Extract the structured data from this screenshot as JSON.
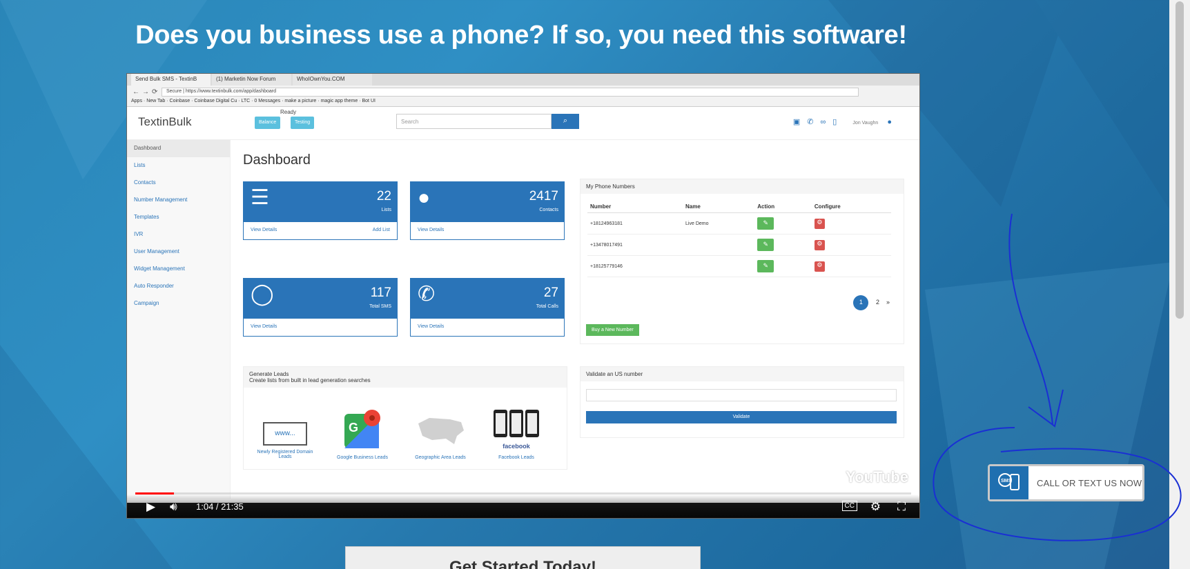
{
  "headline": "Does you business use a phone? If so, you need this software!",
  "video": {
    "browser": {
      "tabs": [
        "Send Bulk SMS - TextinB",
        "(1) Marketin Now Forum",
        "WhoIOwnYou.COM"
      ],
      "url": "Secure | https://www.textinbulk.com/app/dashboard",
      "bookmarks": [
        "Apps",
        "New Tab",
        "Coinbase",
        "Coinbase Digital Cu",
        "LTC",
        "0 Messages",
        "make a picture",
        "magic app theme",
        "Bot UI"
      ]
    },
    "app": {
      "logo": "TextinBulk",
      "status": "Ready",
      "mini_buttons": [
        "Balance",
        "Testing"
      ],
      "search_placeholder": "Search",
      "user_name": "Jon Vaughn",
      "sidebar": [
        "Dashboard",
        "Lists",
        "Contacts",
        "Number Management",
        "Templates",
        "IVR",
        "User Management",
        "Widget Management",
        "Auto Responder",
        "Campaign"
      ],
      "page_title": "Dashboard",
      "cards": [
        {
          "value": "22",
          "label": "Lists",
          "left_link": "View Details",
          "right_link": "Add List"
        },
        {
          "value": "2417",
          "label": "Contacts",
          "left_link": "View Details",
          "right_link": ""
        },
        {
          "value": "117",
          "label": "Total SMS",
          "left_link": "View Details",
          "right_link": ""
        },
        {
          "value": "27",
          "label": "Total Calls",
          "left_link": "View Details",
          "right_link": ""
        }
      ],
      "phone_panel": {
        "title": "My Phone Numbers",
        "headers": [
          "Number",
          "Name",
          "Action",
          "Configure"
        ],
        "rows": [
          {
            "number": "+18124963181",
            "name": "Live Demo"
          },
          {
            "number": "+13478017491",
            "name": ""
          },
          {
            "number": "+18125779146",
            "name": ""
          }
        ],
        "pages": [
          "1",
          "2",
          "»"
        ],
        "buy_button": "Buy a New Number"
      },
      "leads_panel": {
        "title": "Generate Leads",
        "subtitle": "Create lists from built in lead generation searches",
        "tiles": [
          "Newly Registered Domain Leads",
          "Google Business Leads",
          "Geographic Area Leads",
          "Facebook Leads"
        ],
        "www_text": "www...",
        "facebook_text": "facebook"
      },
      "validate_panel": {
        "title": "Validate an US number",
        "button": "Validate"
      }
    },
    "player": {
      "time": "1:04 / 21:35",
      "progress": 0.05,
      "youtube": "YouTube",
      "cc": "CC"
    }
  },
  "cta_button": "Get Started Today!",
  "call_widget": {
    "sms": "SMS",
    "label": "CALL OR TEXT US NOW"
  },
  "colors": {
    "primary": "#2a74b8",
    "success": "#5cb85c",
    "danger": "#d9534f",
    "annotation": "#1a2fd4"
  }
}
